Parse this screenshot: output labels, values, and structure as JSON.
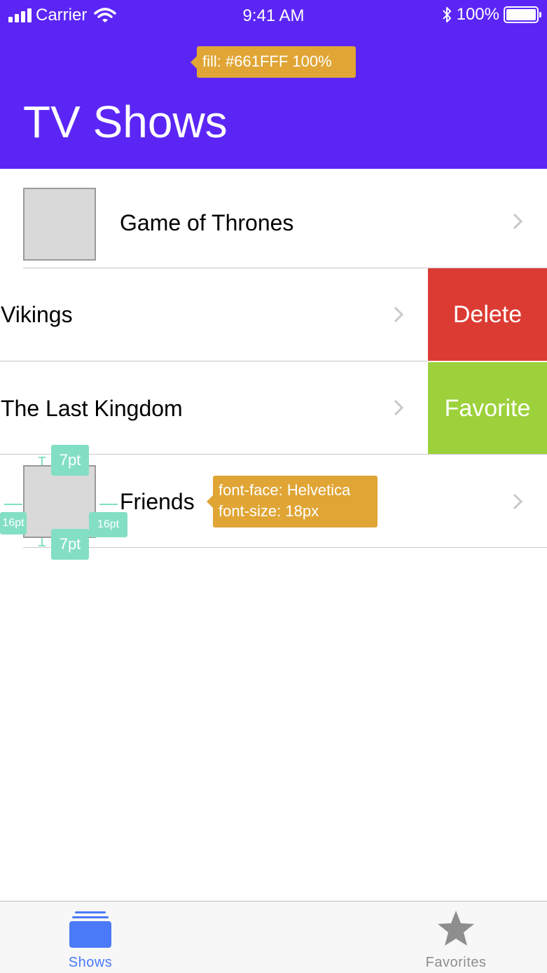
{
  "status_bar": {
    "carrier": "Carrier",
    "time": "9:41 AM",
    "battery": "100%",
    "battery_level": 1.0,
    "signal_bars": 4
  },
  "nav": {
    "title": "TV Shows",
    "background_color": "#5B26F5"
  },
  "annotations": {
    "fill_note": "fill: #661FFF 100%",
    "font_note_line1": "font-face: Helvetica",
    "font_note_line2": "font-size: 18px",
    "spacing_top": "7pt",
    "spacing_bottom": "7pt",
    "spacing_left": "16pt",
    "spacing_right": "16pt",
    "note_color": "#E0A535",
    "measure_color": "#83DFC3"
  },
  "shows": [
    {
      "title": "Game of Thrones",
      "has_thumbnail": true
    },
    {
      "title": "Vikings",
      "has_thumbnail": false,
      "swiped": true
    },
    {
      "title": "The Last Kingdom",
      "has_thumbnail": false,
      "swiped": true
    },
    {
      "title": "Friends",
      "has_thumbnail": true
    }
  ],
  "swipe_actions": {
    "delete_label": "Delete",
    "delete_color": "#DC3B33",
    "favorite_label": "Favorite",
    "favorite_color": "#9CD13B"
  },
  "tab_bar": {
    "tabs": [
      {
        "label": "Shows",
        "icon": "stack-icon",
        "selected": true
      },
      {
        "label": "Favorites",
        "icon": "star-icon",
        "selected": false
      }
    ],
    "selected_color": "#4A7AF7"
  }
}
